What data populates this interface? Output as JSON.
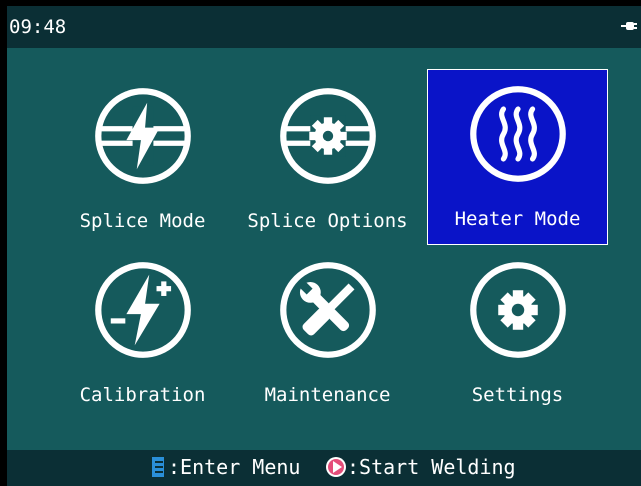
{
  "status": {
    "time": "09:48",
    "battery_icon": "battery-plug-icon"
  },
  "colors": {
    "background": "#155a5c",
    "bar": "#0b2f35",
    "selected": "#0a14c8"
  },
  "menu": {
    "items": [
      {
        "label": "Splice Mode",
        "icon": "splice-lightning-icon",
        "selected": false
      },
      {
        "label": "Splice Options",
        "icon": "splice-gear-icon",
        "selected": false
      },
      {
        "label": "Heater Mode",
        "icon": "heater-waves-icon",
        "selected": true
      },
      {
        "label": "Calibration",
        "icon": "calibration-lightning-plus-icon",
        "selected": false
      },
      {
        "label": "Maintenance",
        "icon": "wrench-screwdriver-icon",
        "selected": false
      },
      {
        "label": "Settings",
        "icon": "gear-icon",
        "selected": false
      }
    ]
  },
  "footer": {
    "enter": ":Enter Menu",
    "start": ":Start Welding",
    "enter_icon": "menu-key-icon",
    "start_icon": "play-key-icon"
  }
}
